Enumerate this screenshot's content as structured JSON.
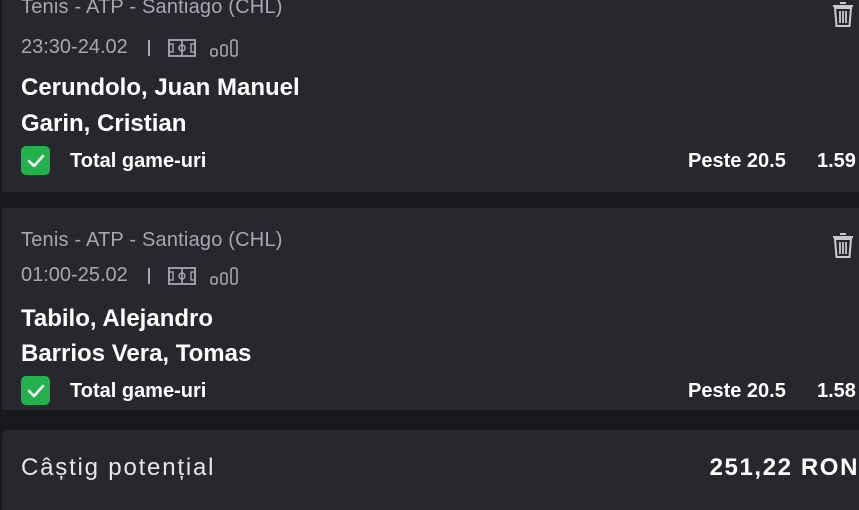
{
  "bets": [
    {
      "league": "Tenis - ATP - Santiago (CHL)",
      "datetime": "23:30-24.02",
      "team1": "Cerundolo, Juan Manuel",
      "team2": "Garin, Cristian",
      "market": "Total game-uri",
      "pick": "Peste 20.5",
      "odds": "1.59"
    },
    {
      "league": "Tenis - ATP - Santiago (CHL)",
      "datetime": "01:00-25.02",
      "team1": "Tabilo, Alejandro",
      "team2": "Barrios Vera, Tomas",
      "market": "Total game-uri",
      "pick": "Peste 20.5",
      "odds": "1.58"
    }
  ],
  "summary": {
    "label": "Câștig potențial",
    "value": "251,22 RON"
  },
  "icons": [
    "field-icon",
    "stats-icon",
    "trash-icon",
    "checkmark-icon"
  ],
  "colors": {
    "background": "#18191d",
    "card": "#27282e",
    "check": "#22b14c",
    "muted_text": "#a6a8ae"
  }
}
